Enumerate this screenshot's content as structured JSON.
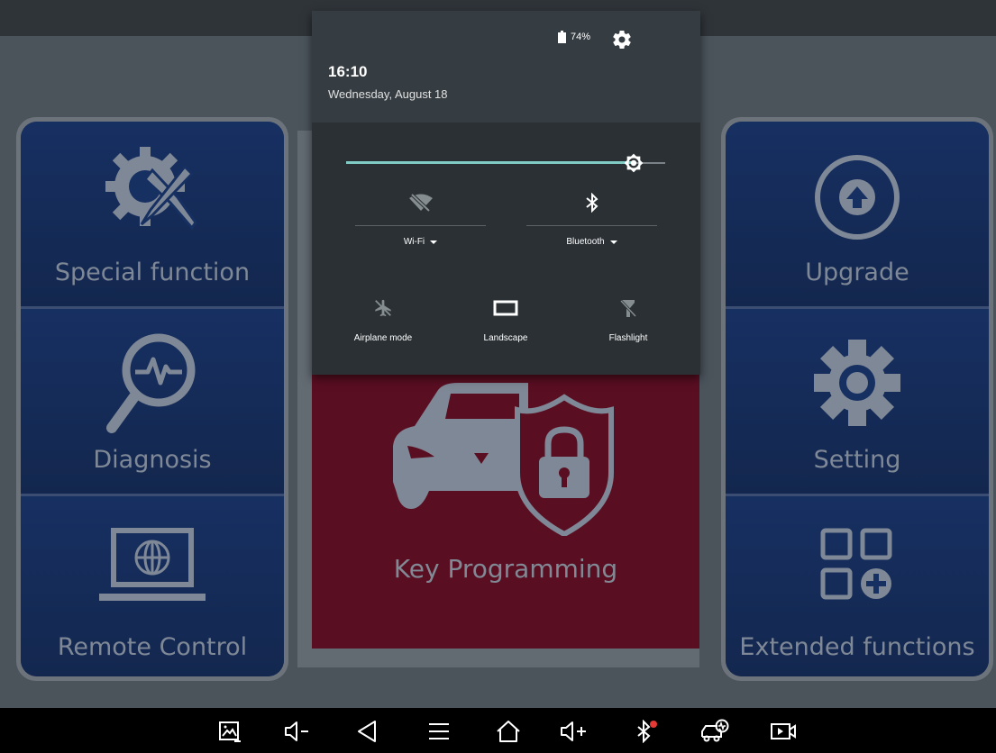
{
  "status": {
    "time": "16:10",
    "date": "Wednesday, August 18",
    "battery": "74%"
  },
  "quick_settings": {
    "brightness_fraction": 0.9,
    "wifi_label": "Wi-Fi",
    "bluetooth_label": "Bluetooth",
    "airplane_label": "Airplane mode",
    "landscape_label": "Landscape",
    "flashlight_label": "Flashlight"
  },
  "left_panel": {
    "special": "Special function",
    "diagnosis": "Diagnosis",
    "remote": "Remote Control"
  },
  "center": {
    "label": "Key Programming"
  },
  "right_panel": {
    "upgrade": "Upgrade",
    "setting": "Setting",
    "extended": "Extended functions"
  },
  "colors": {
    "tile_bg": "#173062",
    "center_bg": "#5a0e22",
    "shade_bg": "#2a3034",
    "accent": "#80cbc4",
    "icon": "#7f8896"
  },
  "icons": {
    "nav": [
      "screenshot-icon",
      "volume-down-icon",
      "back-icon",
      "menu-icon",
      "home-icon",
      "volume-up-icon",
      "bluetooth-icon",
      "car-diagnostic-icon",
      "screen-record-icon"
    ]
  }
}
